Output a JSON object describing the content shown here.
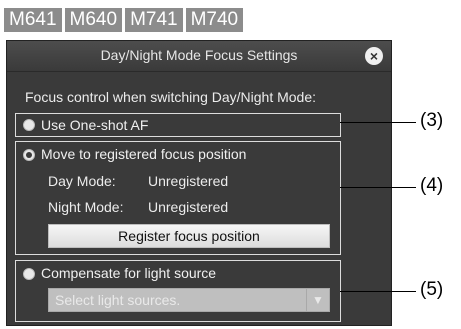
{
  "models": [
    "M641",
    "M640",
    "M741",
    "M740"
  ],
  "dialog": {
    "title": "Day/Night Mode Focus Settings",
    "intro": "Focus control when switching Day/Night Mode:",
    "options": {
      "one_shot": {
        "label": "Use One-shot AF"
      },
      "move_to_registered": {
        "label": "Move to registered focus position",
        "day_key": "Day Mode:",
        "day_value": "Unregistered",
        "night_key": "Night Mode:",
        "night_value": "Unregistered",
        "button_label": "Register focus position"
      },
      "compensate": {
        "label": "Compensate for light source",
        "select_placeholder": "Select light sources."
      }
    }
  },
  "callouts": {
    "c3": "(3)",
    "c4": "(4)",
    "c5": "(5)"
  },
  "icons": {
    "close": "close-icon",
    "dropdown": "chevron-down-icon"
  },
  "colors": {
    "badge": "#8c8c8c",
    "dialog_bg": "#3a3a3a"
  }
}
